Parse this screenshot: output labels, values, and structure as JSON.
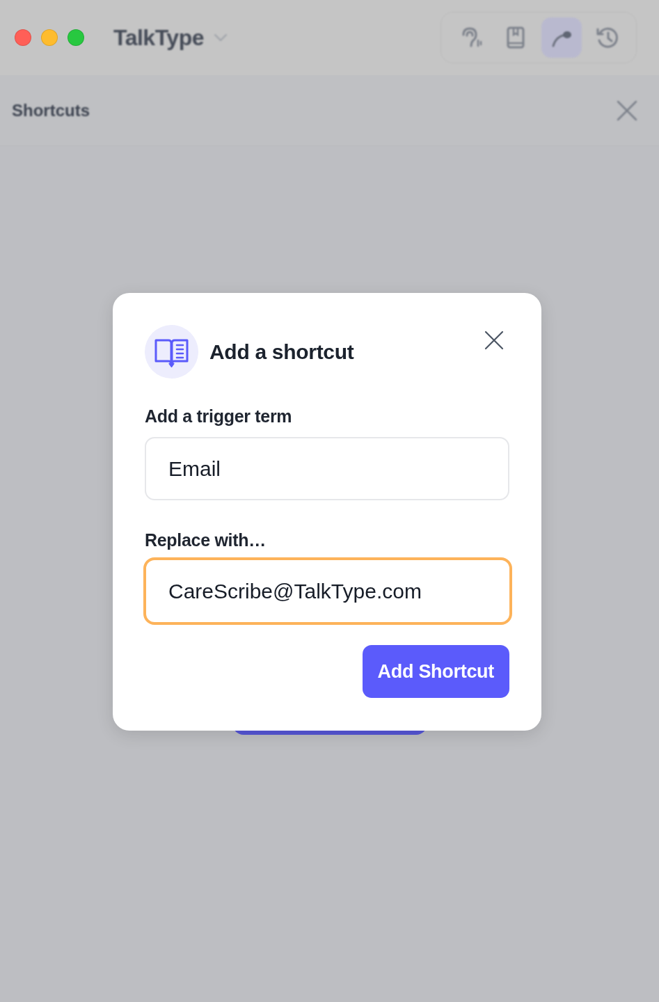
{
  "window": {
    "title": "TalkType"
  },
  "toolbar": [
    {
      "selected": false
    },
    {
      "selected": false
    },
    {
      "selected": true
    },
    {
      "selected": false
    }
  ],
  "panel": {
    "title": "Shortcuts"
  },
  "dialog": {
    "title": "Add a shortcut",
    "fields": [
      {
        "label": "Add a trigger term",
        "value": "Email",
        "focused": false
      },
      {
        "label": "Replace with…",
        "value": "CareScribe@TalkType.com",
        "focused": true
      }
    ],
    "submit": "Add Shortcut"
  }
}
